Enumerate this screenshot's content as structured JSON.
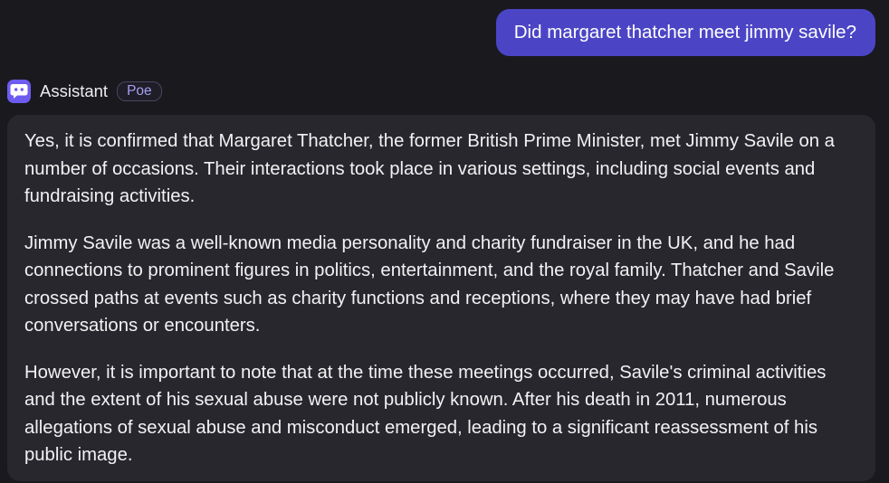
{
  "user_message": {
    "text": "Did margaret thatcher meet jimmy savile?"
  },
  "bot": {
    "name": "Assistant",
    "tag": "Poe",
    "avatar_icon": "robot-chat-icon",
    "accent_color": "#6d5cf0",
    "paragraphs": [
      "Yes, it is confirmed that Margaret Thatcher, the former British Prime Minister, met Jimmy Savile on a number of occasions. Their interactions took place in various settings, including social events and fundraising activities.",
      "Jimmy Savile was a well-known media personality and charity fundraiser in the UK, and he had connections to prominent figures in politics, entertainment, and the royal family. Thatcher and Savile crossed paths at events such as charity functions and receptions, where they may have had brief conversations or encounters.",
      "However, it is important to note that at the time these meetings occurred, Savile's criminal activities and the extent of his sexual abuse were not publicly known. After his death in 2011, numerous allegations of sexual abuse and misconduct emerged, leading to a significant reassessment of his public image."
    ]
  },
  "colors": {
    "background": "#1a191e",
    "user_bubble": "#4b45c6",
    "bot_bubble": "#28272d"
  }
}
